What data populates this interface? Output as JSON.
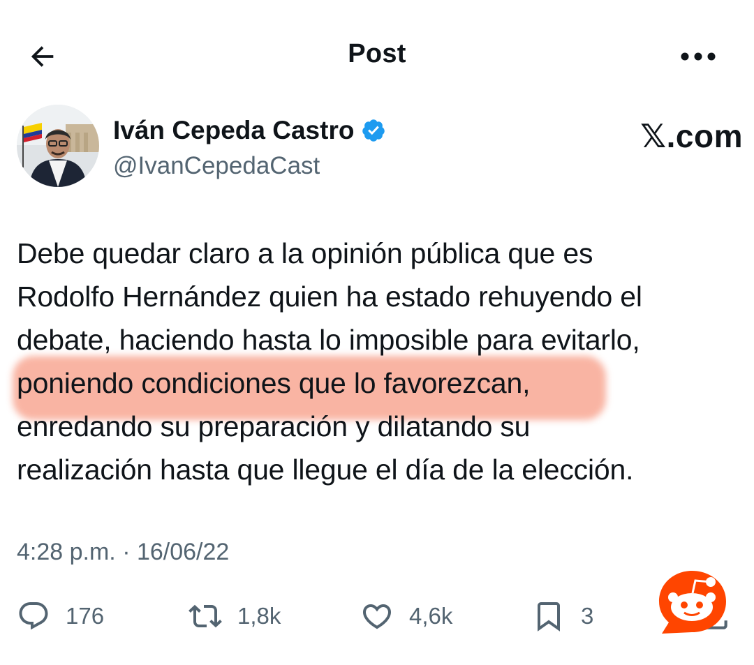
{
  "header": {
    "title": "Post",
    "back_icon": "arrow-left-icon",
    "more_icon": "more-horizontal-icon"
  },
  "author": {
    "name": "Iván Cepeda Castro",
    "handle": "@IvanCepedaCast",
    "verified": true,
    "verified_color": "#1d9bf0"
  },
  "source_mark": "𝕏.com",
  "tweet": {
    "lines": [
      "Debe quedar claro a la opinión pública que es",
      "Rodolfo Hernández quien ha estado rehuyendo el",
      "debate, haciendo hasta lo imposible para evitarlo,",
      "poniendo condiciones que lo favorezcan,",
      "enredando su preparación y dilatando su",
      "realización hasta que llegue el día de la elección."
    ],
    "highlight_color": "#f8a48f"
  },
  "timestamp": "4:28 p.m. · 16/06/22",
  "actions": {
    "replies": "176",
    "reposts": "1,8k",
    "likes": "4,6k",
    "bookmarks": "3"
  },
  "colors": {
    "text": "#0f1419",
    "secondary": "#536471",
    "reddit_orange": "#ff4500"
  }
}
